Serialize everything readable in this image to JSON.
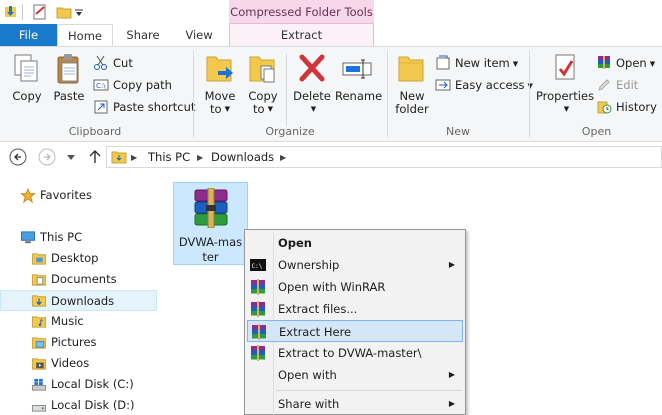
{
  "titlebar": {
    "context_header": "Compressed Folder Tools"
  },
  "tabs": {
    "file": "File",
    "home": "Home",
    "share": "Share",
    "view": "View",
    "extract": "Extract"
  },
  "ribbon": {
    "clipboard": {
      "label": "Clipboard",
      "copy": "Copy",
      "paste": "Paste",
      "cut": "Cut",
      "copy_path": "Copy path",
      "paste_shortcut": "Paste shortcut"
    },
    "organize": {
      "label": "Organize",
      "move_to_l1": "Move",
      "move_to_l2": "to",
      "copy_to_l1": "Copy",
      "copy_to_l2": "to",
      "delete": "Delete",
      "rename": "Rename"
    },
    "new": {
      "label": "New",
      "new_folder_l1": "New",
      "new_folder_l2": "folder",
      "new_item": "New item",
      "easy_access": "Easy access"
    },
    "open": {
      "label": "Open",
      "properties": "Properties",
      "open": "Open",
      "edit": "Edit",
      "history": "History"
    }
  },
  "address": {
    "crumbs": [
      "This PC",
      "Downloads"
    ]
  },
  "navpane": {
    "favorites": "Favorites",
    "this_pc": "This PC",
    "items": [
      "Desktop",
      "Documents",
      "Downloads",
      "Music",
      "Pictures",
      "Videos",
      "Local Disk (C:)",
      "Local Disk (D:)"
    ]
  },
  "file": {
    "name_l1": "DVWA-mas",
    "name_l2": "ter"
  },
  "context_menu": {
    "items": [
      {
        "label": "Open"
      },
      {
        "label": "Ownership"
      },
      {
        "label": "Open with WinRAR"
      },
      {
        "label": "Extract files..."
      },
      {
        "label": "Extract Here"
      },
      {
        "label": "Extract to DVWA-master\\"
      },
      {
        "label": "Open with"
      },
      {
        "label": "Share with"
      }
    ]
  },
  "colors": {
    "accent": "#1979ca",
    "context_tab": "#f7d8ea",
    "selection": "#cce8ff",
    "menu_hover": "#d5e6f7"
  }
}
